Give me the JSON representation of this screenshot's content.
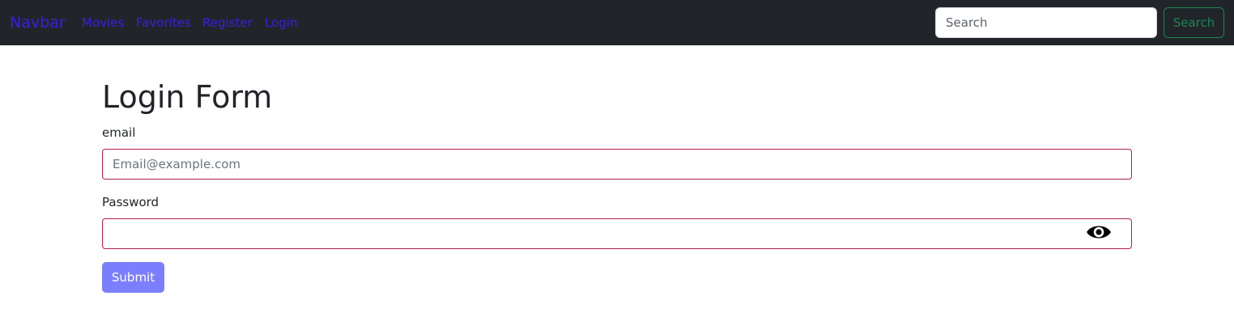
{
  "navbar": {
    "brand": "Navbar",
    "links": [
      {
        "label": "Movies"
      },
      {
        "label": "Favorites"
      },
      {
        "label": "Register"
      },
      {
        "label": "Login"
      }
    ],
    "search": {
      "placeholder": "Search",
      "button_label": "Search"
    }
  },
  "form": {
    "title": "Login Form",
    "email_label": "email",
    "email_placeholder": "Email@example.com",
    "password_label": "Password",
    "password_value": "",
    "submit_label": "Submit"
  },
  "colors": {
    "navbar_bg": "#212529",
    "link": "#3d1ce6",
    "success": "#198754",
    "invalid_border": "#b21f4d",
    "submit_bg": "#7b7fff"
  },
  "icons": {
    "password_toggle": "eye-icon"
  }
}
